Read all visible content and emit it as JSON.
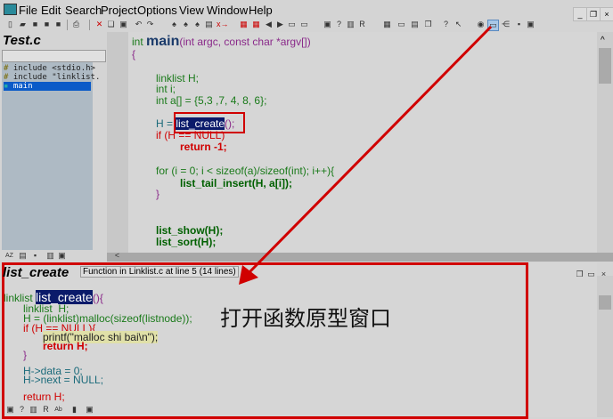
{
  "menu": [
    "File",
    "Edit",
    "Search",
    "Project",
    "Options",
    "View",
    "Window",
    "Help"
  ],
  "left_panel": {
    "title": "Test.c",
    "symbols": [
      "include <stdio.h>",
      "include \"linklist.",
      "main"
    ],
    "selected": "main"
  },
  "editor": {
    "signature": {
      "ret": "int",
      "name": "main",
      "params": "(int argc, const char *argv[])"
    },
    "lines": [
      "{",
      "linklist H;",
      "int i;",
      "int a[] = {5,3 ,7, 4, 8, 6};",
      "H = ",
      "list_create",
      "();",
      "if (H == NULL)",
      "return -1;",
      "for (i = 0; i < sizeof(a)/sizeof(int); i++){",
      "list_tail_insert(H, a[i]);",
      "}",
      "list_show(H);",
      "list_sort(H);"
    ]
  },
  "context": {
    "title": "list_create",
    "info": "Function in Linklist.c at line 5 (14 lines)",
    "lines": [
      "linklist ",
      "list_create",
      "(){",
      "linklist  H;",
      "H = (linklist)malloc(sizeof(listnode));",
      "if (H == NULL){",
      "printf(\"malloc shi bai\\n\");",
      "return H;",
      "}",
      "H->data = 0;",
      "H->next = NULL;",
      "return H;"
    ]
  },
  "annotation": "打开函数原型窗口",
  "colors": {
    "highlight": "#d00000",
    "selection": "#0a1a6a"
  }
}
